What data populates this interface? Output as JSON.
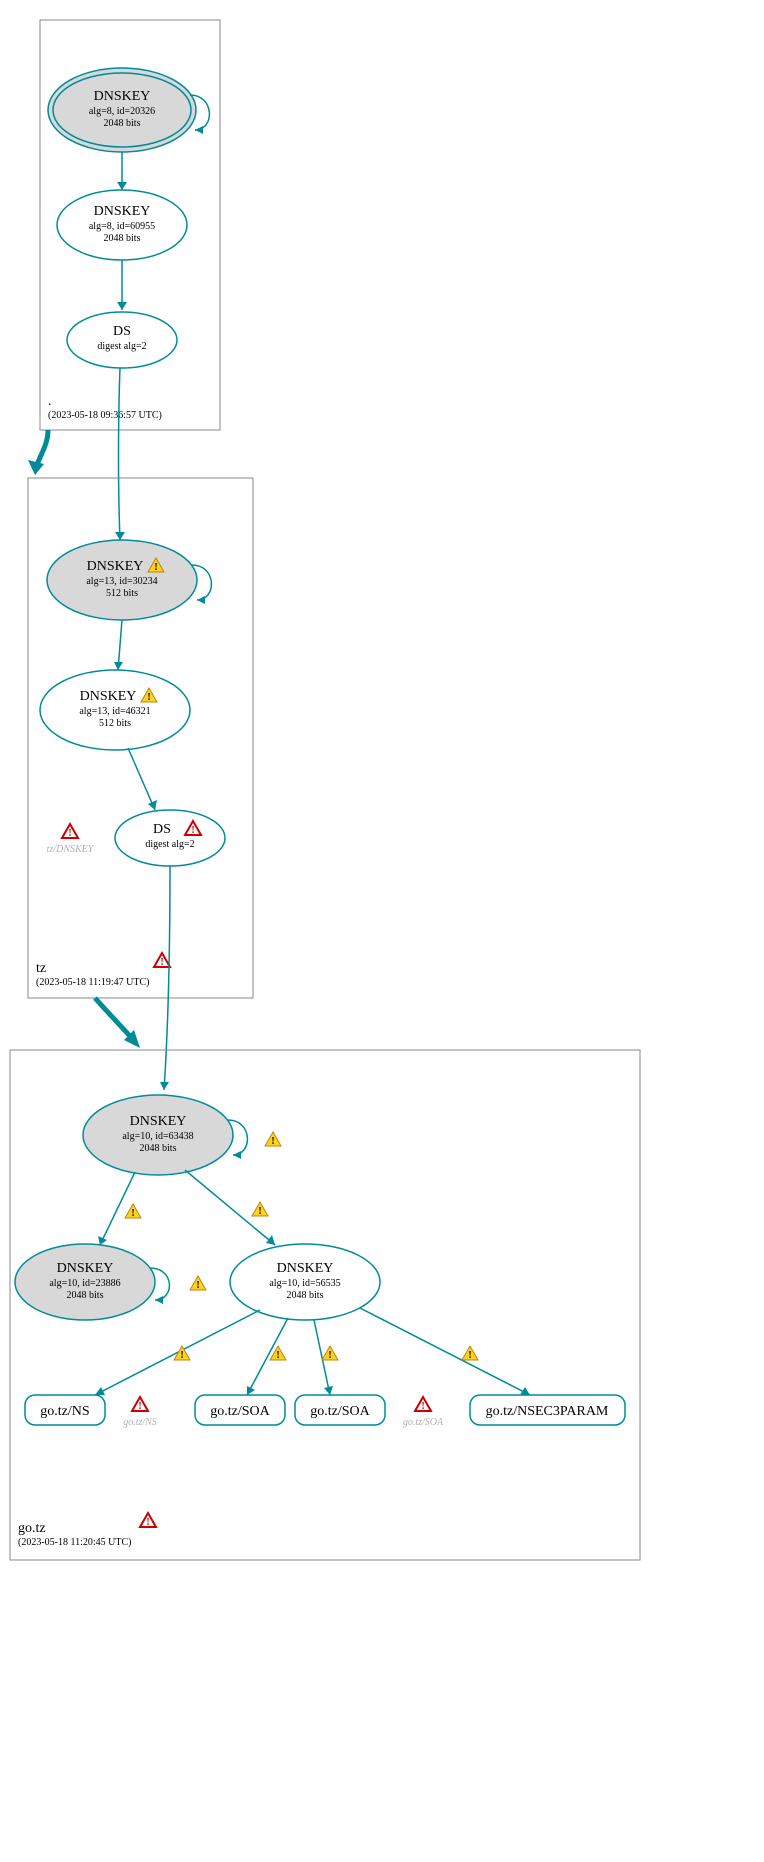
{
  "zones": {
    "root": {
      "label": ".",
      "timestamp": "(2023-05-18 09:36:57 UTC)"
    },
    "tz": {
      "label": "tz",
      "timestamp": "(2023-05-18 11:19:47 UTC)"
    },
    "gotz": {
      "label": "go.tz",
      "timestamp": "(2023-05-18 11:20:45 UTC)"
    }
  },
  "nodes": {
    "root_ksk": {
      "title": "DNSKEY",
      "l1": "alg=8, id=20326",
      "l2": "2048 bits"
    },
    "root_zsk": {
      "title": "DNSKEY",
      "l1": "alg=8, id=60955",
      "l2": "2048 bits"
    },
    "root_ds": {
      "title": "DS",
      "l1": "digest alg=2"
    },
    "tz_ksk": {
      "title": "DNSKEY ",
      "l1": "alg=13, id=30234",
      "l2": "512 bits"
    },
    "tz_zsk": {
      "title": "DNSKEY ",
      "l1": "alg=13, id=46321",
      "l2": "512 bits"
    },
    "tz_ds": {
      "title": "DS ",
      "l1": "digest alg=2"
    },
    "gotz_ksk": {
      "title": "DNSKEY",
      "l1": "alg=10, id=63438",
      "l2": "2048 bits"
    },
    "gotz_k2": {
      "title": "DNSKEY",
      "l1": "alg=10, id=23886",
      "l2": "2048 bits"
    },
    "gotz_zsk": {
      "title": "DNSKEY",
      "l1": "alg=10, id=56535",
      "l2": "2048 bits"
    },
    "rr_ns": {
      "label": "go.tz/NS"
    },
    "rr_soa1": {
      "label": "go.tz/SOA"
    },
    "rr_soa2": {
      "label": "go.tz/SOA"
    },
    "rr_nsec3": {
      "label": "go.tz/NSEC3PARAM"
    }
  },
  "ghosts": {
    "tz_dnskey": "tz/DNSKEY",
    "gotz_ns": "go.tz/NS",
    "gotz_soa": "go.tz/SOA"
  }
}
